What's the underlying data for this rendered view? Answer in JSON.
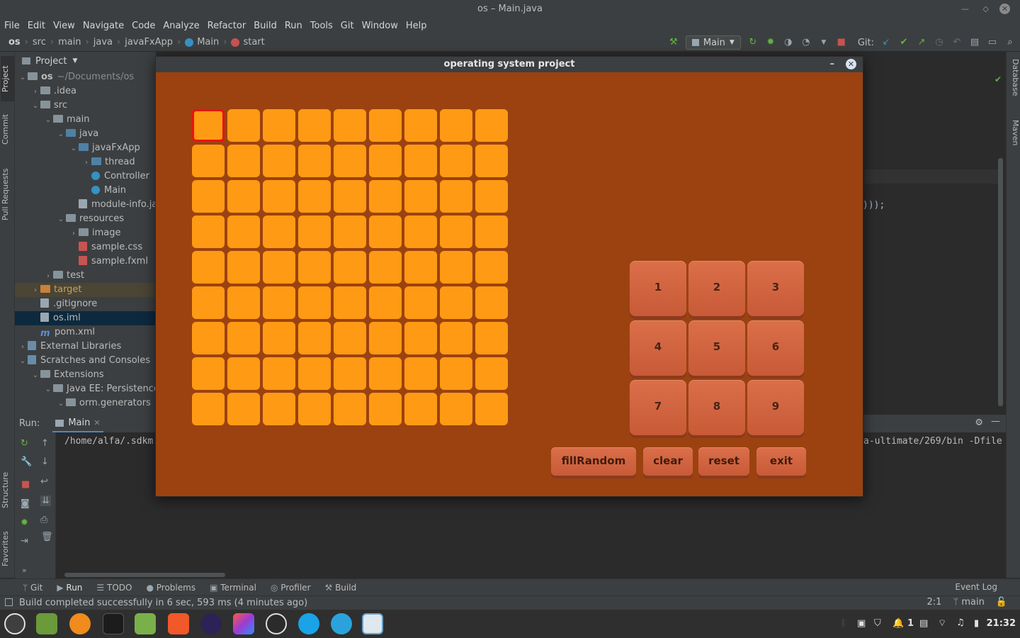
{
  "window_title": "os – Main.java",
  "menu": [
    "File",
    "Edit",
    "View",
    "Navigate",
    "Code",
    "Analyze",
    "Refactor",
    "Build",
    "Run",
    "Tools",
    "Git",
    "Window",
    "Help"
  ],
  "breadcrumb": [
    "os",
    "src",
    "main",
    "java",
    "javaFxApp",
    "Main",
    "start"
  ],
  "run_config": "Main",
  "git_label": "Git:",
  "left_tabs": [
    "Project",
    "Commit",
    "Pull Requests",
    "Structure",
    "Favorites"
  ],
  "right_tabs": [
    "Database",
    "Maven"
  ],
  "project": {
    "header": "Project",
    "rows": [
      {
        "label": "os",
        "suffix": "~/Documents/os",
        "depth": 0,
        "kind": "folder"
      },
      {
        "label": ".idea",
        "depth": 1,
        "kind": "folder"
      },
      {
        "label": "src",
        "depth": 1,
        "kind": "folder"
      },
      {
        "label": "main",
        "depth": 2,
        "kind": "folder"
      },
      {
        "label": "java",
        "depth": 3,
        "kind": "folder"
      },
      {
        "label": "javaFxApp",
        "depth": 4,
        "kind": "folder"
      },
      {
        "label": "thread",
        "depth": 5,
        "kind": "folder"
      },
      {
        "label": "Controller",
        "depth": 5,
        "kind": "class"
      },
      {
        "label": "Main",
        "depth": 5,
        "kind": "class"
      },
      {
        "label": "module-info.ja",
        "depth": 4,
        "kind": "file"
      },
      {
        "label": "resources",
        "depth": 3,
        "kind": "folder"
      },
      {
        "label": "image",
        "depth": 4,
        "kind": "folder"
      },
      {
        "label": "sample.css",
        "depth": 4,
        "kind": "css"
      },
      {
        "label": "sample.fxml",
        "depth": 4,
        "kind": "css"
      },
      {
        "label": "test",
        "depth": 2,
        "kind": "folder"
      },
      {
        "label": "target",
        "depth": 1,
        "kind": "folder"
      },
      {
        "label": ".gitignore",
        "depth": 1,
        "kind": "file"
      },
      {
        "label": "os.iml",
        "depth": 1,
        "kind": "file"
      },
      {
        "label": "pom.xml",
        "depth": 1,
        "kind": "maven"
      },
      {
        "label": "External Libraries",
        "depth": 0,
        "kind": "lib"
      },
      {
        "label": "Scratches and Consoles",
        "depth": 0,
        "kind": "lib"
      },
      {
        "label": "Extensions",
        "depth": 1,
        "kind": "folder"
      },
      {
        "label": "Java EE: Persistence",
        "depth": 2,
        "kind": "folder"
      },
      {
        "label": "orm.generators",
        "depth": 3,
        "kind": "folder"
      }
    ]
  },
  "editor_code": ")));",
  "run": {
    "label": "Run:",
    "tab": "Main",
    "line_left": "/home/alfa/.sdkm",
    "line_right": "a-ultimate/269/bin -Dfile"
  },
  "bottom_tabs": [
    "Git",
    "Run",
    "TODO",
    "Problems",
    "Terminal",
    "Profiler",
    "Build"
  ],
  "event_log": "Event Log",
  "status": {
    "message": "Build completed successfully in 6 sec, 593 ms (4 minutes ago)",
    "position": "2:1",
    "branch": "main"
  },
  "taskbar": {
    "clock": "21:32",
    "tray_count": "1"
  },
  "fx": {
    "title": "operating system project",
    "grid_rows": 9,
    "grid_cols": 9,
    "selected_cell": [
      0,
      0
    ],
    "cell_color": "#ff9a14",
    "bg_color": "#9b4210",
    "numbers": [
      "1",
      "2",
      "3",
      "4",
      "5",
      "6",
      "7",
      "8",
      "9"
    ],
    "actions": [
      "fillRandom",
      "clear",
      "reset",
      "exit"
    ]
  }
}
